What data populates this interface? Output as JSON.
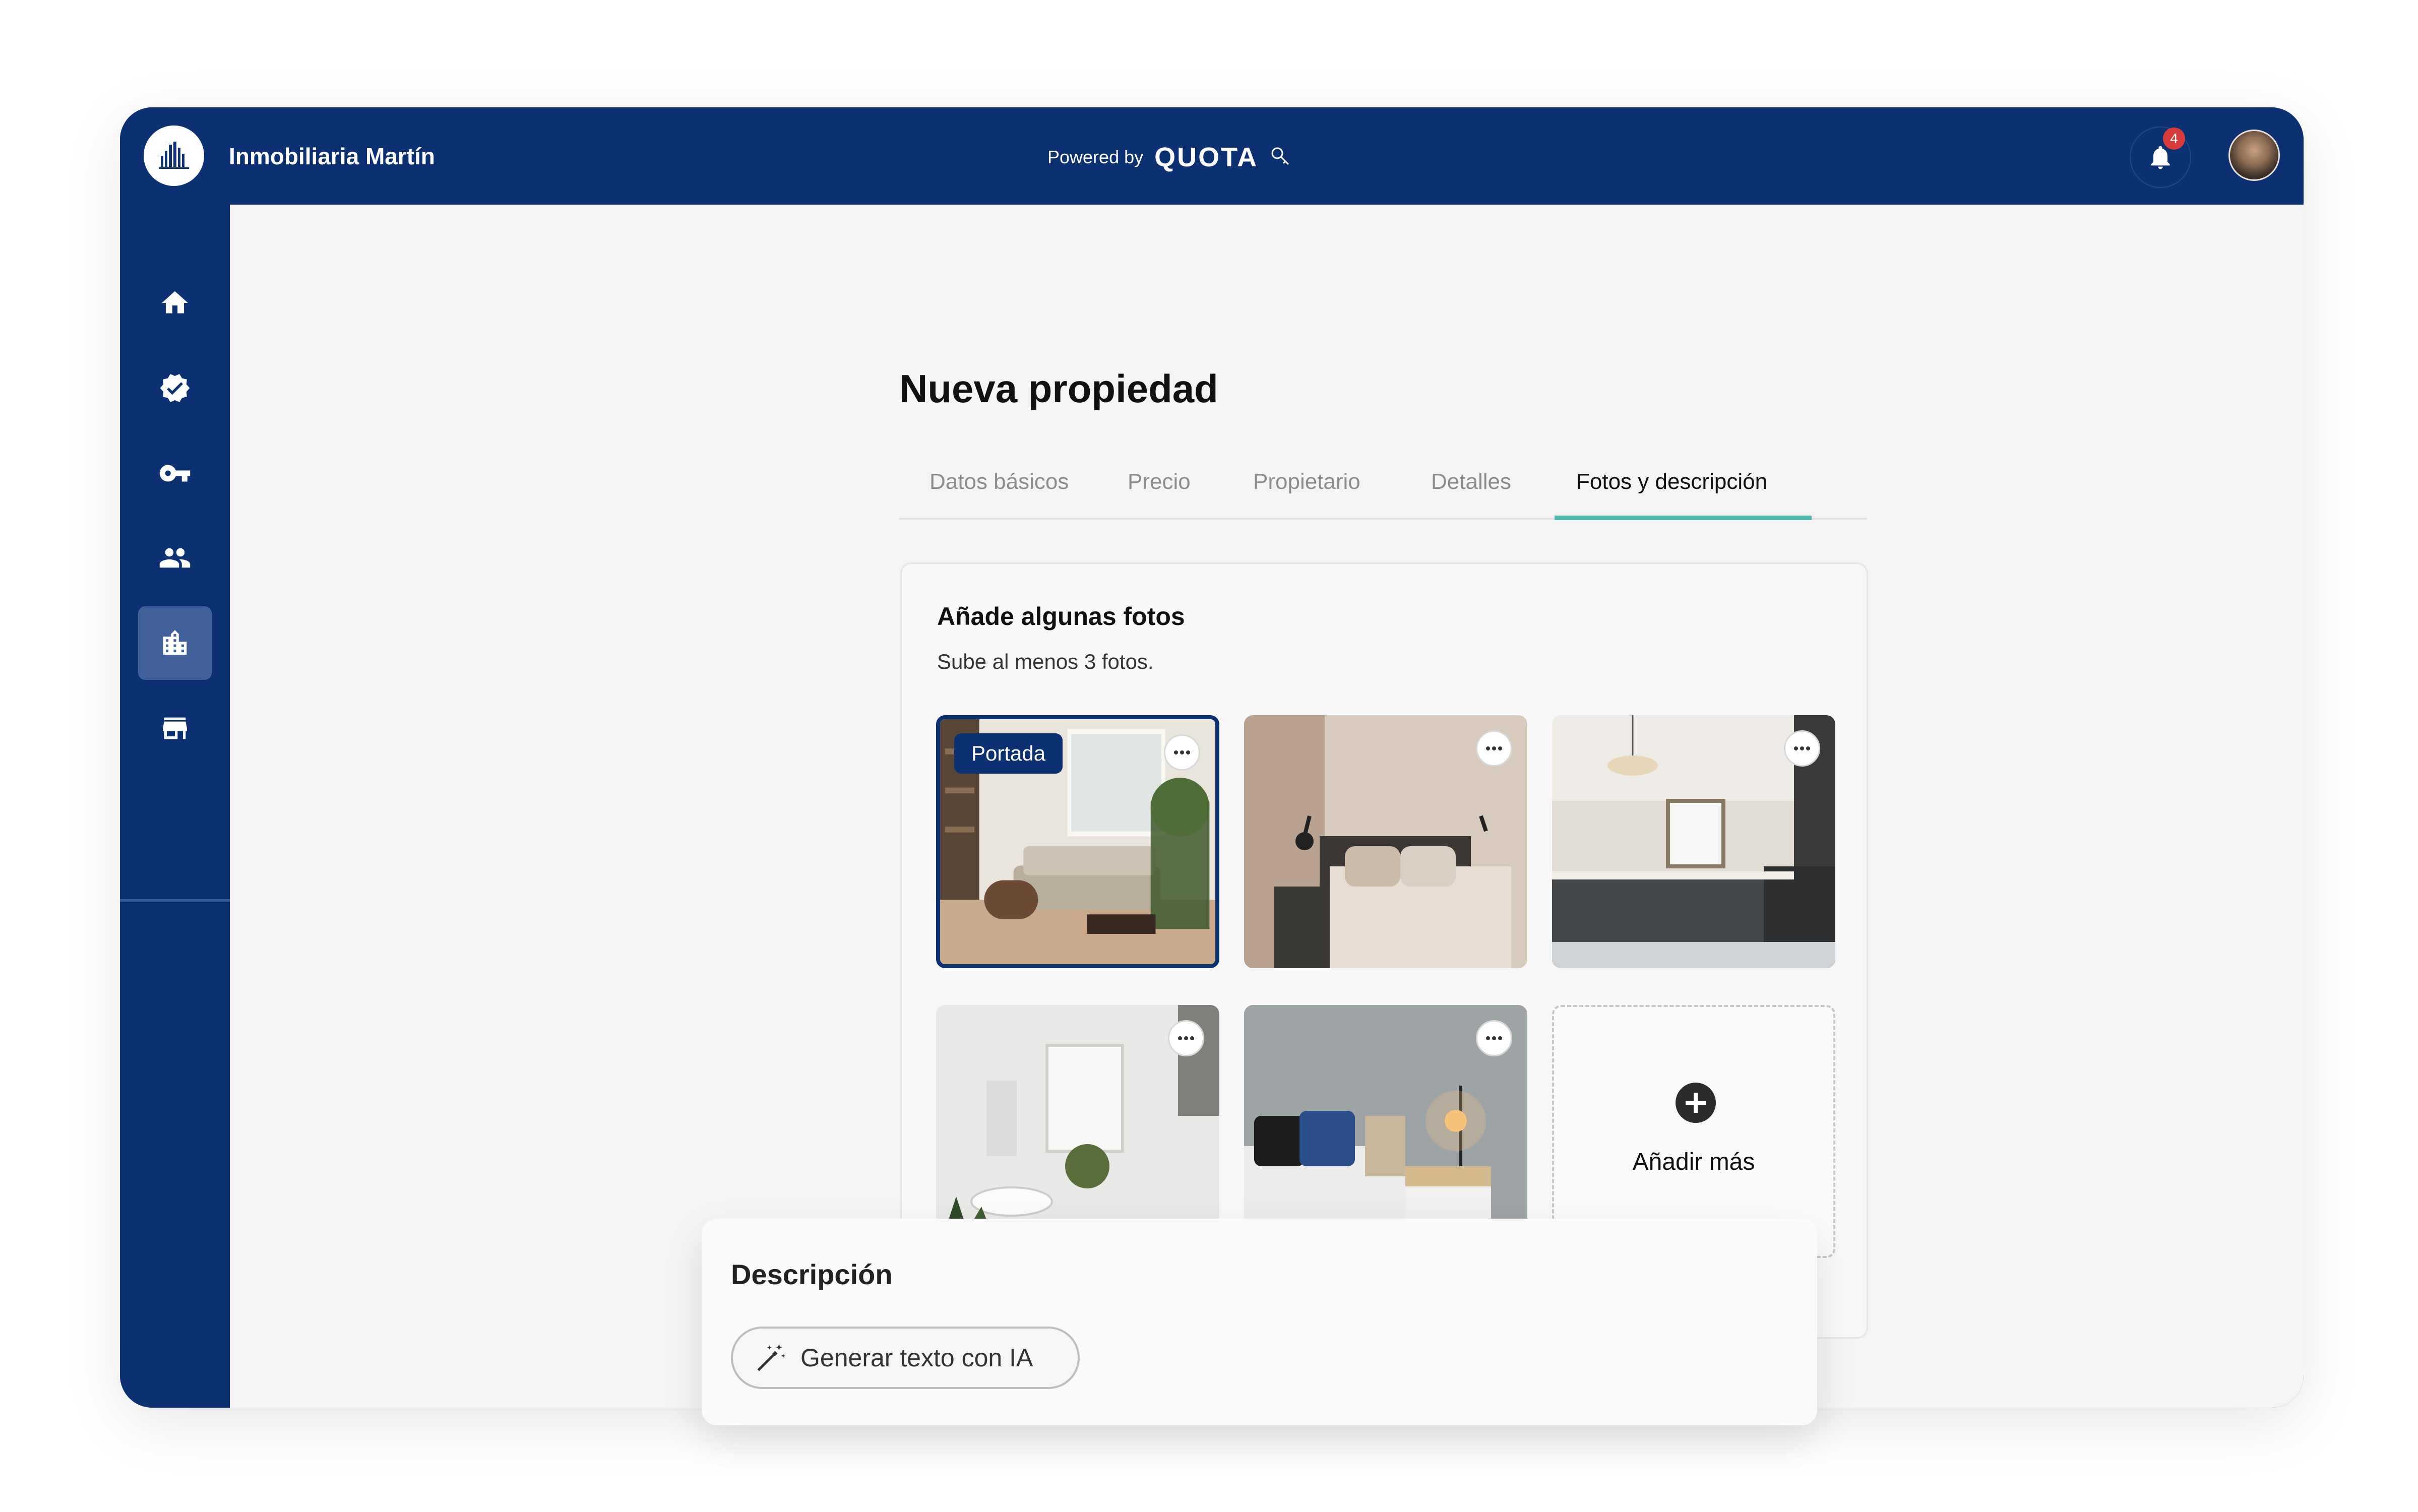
{
  "app": {
    "brand_name": "Inmobiliaria Martín",
    "logo_icon": "building-skyline-icon",
    "powered_by_label": "Powered by",
    "powered_by_brand": "QUOTA",
    "notifications_count": "4",
    "colors": {
      "primary": "#0b3172",
      "accent": "#4fb8ae",
      "badge": "#d93b3b",
      "background": "#f4f4f4"
    }
  },
  "sidebar": {
    "items": [
      {
        "icon": "home-icon",
        "active": false
      },
      {
        "icon": "verified-badge-icon",
        "active": false
      },
      {
        "icon": "key-icon",
        "active": false
      },
      {
        "icon": "people-icon",
        "active": false
      },
      {
        "icon": "building-icon",
        "active": true
      },
      {
        "icon": "store-icon",
        "active": false
      }
    ]
  },
  "page": {
    "title": "Nueva propiedad",
    "tabs": [
      {
        "label": "Datos básicos",
        "active": false
      },
      {
        "label": "Precio",
        "active": false
      },
      {
        "label": "Propietario",
        "active": false
      },
      {
        "label": "Detalles",
        "active": false
      },
      {
        "label": "Fotos y descripción",
        "active": true
      }
    ]
  },
  "photos": {
    "title": "Añade algunas fotos",
    "subtitle": "Sube al menos 3 fotos.",
    "cover_label": "Portada",
    "add_more_label": "Añadir más",
    "items": [
      {
        "scene": "living-room",
        "cover": true
      },
      {
        "scene": "bedroom",
        "cover": false
      },
      {
        "scene": "kitchen",
        "cover": false
      },
      {
        "scene": "bathroom",
        "cover": false
      },
      {
        "scene": "bedroom-lamp",
        "cover": false
      }
    ]
  },
  "description": {
    "title": "Descripción",
    "ai_button_label": "Generar texto con IA",
    "ai_button_icon": "magic-wand-icon"
  }
}
